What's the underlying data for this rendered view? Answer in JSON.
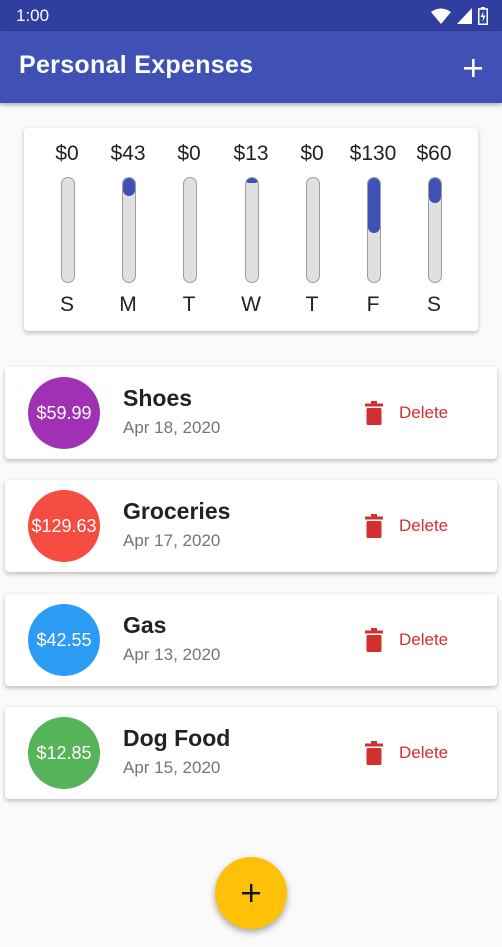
{
  "status_bar": {
    "time": "1:00"
  },
  "app_bar": {
    "title": "Personal Expenses",
    "add_icon": "plus-icon"
  },
  "chart_data": {
    "type": "bar",
    "categories": [
      "S",
      "M",
      "T",
      "W",
      "T",
      "F",
      "S"
    ],
    "values": [
      0,
      43,
      0,
      13,
      0,
      130,
      60
    ],
    "labels": [
      "$0",
      "$43",
      "$0",
      "$13",
      "$0",
      "$130",
      "$60"
    ],
    "max_total": 246,
    "bar_color": "#3f51b5"
  },
  "transactions": [
    {
      "title": "Shoes",
      "date": "Apr 18, 2020",
      "amount": "$59.99",
      "color": "#9c27b0",
      "delete_label": "Delete"
    },
    {
      "title": "Groceries",
      "date": "Apr 17, 2020",
      "amount": "$129.63",
      "color": "#f44336",
      "delete_label": "Delete"
    },
    {
      "title": "Gas",
      "date": "Apr 13, 2020",
      "amount": "$42.55",
      "color": "#2196f3",
      "delete_label": "Delete"
    },
    {
      "title": "Dog Food",
      "date": "Apr 15, 2020",
      "amount": "$12.85",
      "color": "#4caf50",
      "delete_label": "Delete"
    }
  ],
  "fab": {
    "icon": "plus-icon",
    "color": "#ffc107"
  }
}
